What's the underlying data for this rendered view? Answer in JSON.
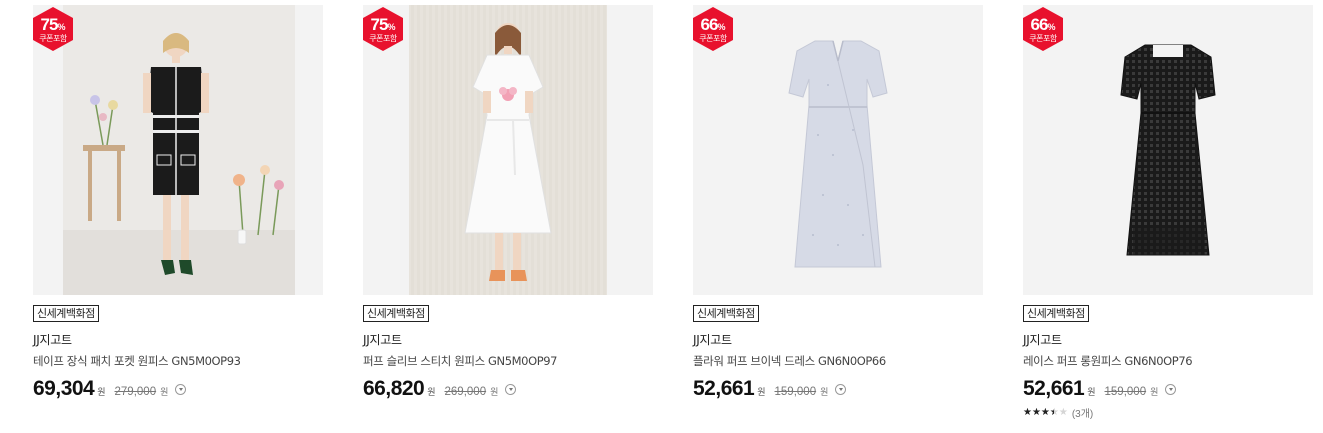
{
  "products": [
    {
      "discount": "75",
      "discount_unit": "%",
      "coupon_label": "쿠폰포함",
      "store": "신세계백화점",
      "brand": "JJ지고트",
      "name": "테이프 장식 패치 포켓 원피스 GN5M0OP93",
      "price": "69,304",
      "price_unit": "원",
      "original_price": "279,000",
      "original_unit": "원"
    },
    {
      "discount": "75",
      "discount_unit": "%",
      "coupon_label": "쿠폰포함",
      "store": "신세계백화점",
      "brand": "JJ지고트",
      "name": "퍼프 슬리브 스티치 원피스 GN5M0OP97",
      "price": "66,820",
      "price_unit": "원",
      "original_price": "269,000",
      "original_unit": "원"
    },
    {
      "discount": "66",
      "discount_unit": "%",
      "coupon_label": "쿠폰포함",
      "store": "신세계백화점",
      "brand": "JJ지고트",
      "name": "플라워 퍼프 브이넥 드레스 GN6N0OP66",
      "price": "52,661",
      "price_unit": "원",
      "original_price": "159,000",
      "original_unit": "원"
    },
    {
      "discount": "66",
      "discount_unit": "%",
      "coupon_label": "쿠폰포함",
      "store": "신세계백화점",
      "brand": "JJ지고트",
      "name": "레이스 퍼프 롱원피스 GN6N0OP76",
      "price": "52,661",
      "price_unit": "원",
      "original_price": "159,000",
      "original_unit": "원",
      "rating": 3.5,
      "review_count": "(3개)"
    }
  ],
  "colors": {
    "badge": "#e8112d",
    "price": "#111111"
  }
}
